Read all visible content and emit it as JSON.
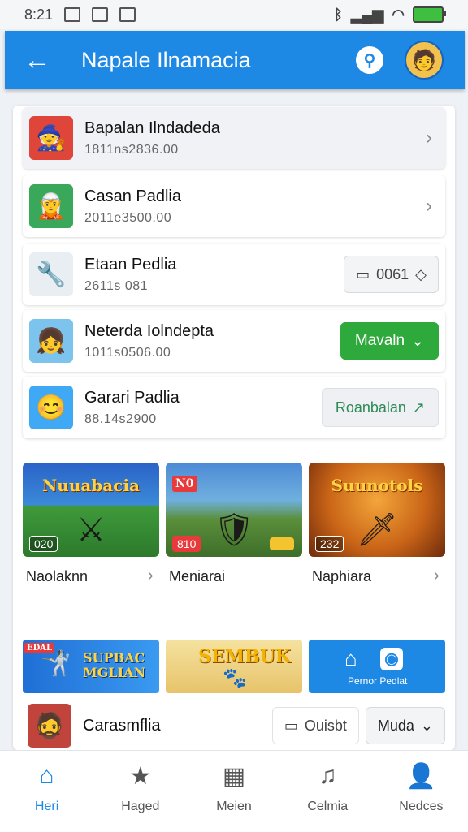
{
  "status": {
    "time": "8:21",
    "battery_color": "#3fbf3f"
  },
  "app_bar": {
    "title": "Napale Ilnamacia",
    "color": "#1e88e5"
  },
  "list_items": [
    {
      "title": "Bapalan Ilndadeda",
      "subtitle": "1811ns2836.00",
      "action": "chevron"
    },
    {
      "title": "Casan Padlia",
      "subtitle": "2011e3500.00",
      "action": "chevron"
    },
    {
      "title": "Etaan Pedlia",
      "subtitle": "2611s 081",
      "action": "outline",
      "action_label": "0061"
    },
    {
      "title": "Neterda Iolndepta",
      "subtitle": "1011s0506.00",
      "action": "green",
      "action_label": "Mavaln"
    },
    {
      "title": "Garari Padlia",
      "subtitle": "88.14s2900",
      "action": "light",
      "action_label": "Roanbalan"
    }
  ],
  "tiles": [
    {
      "title": "Nuuabacia",
      "tag": "020",
      "label": "Naolaknn"
    },
    {
      "title": "N0",
      "tag": "810",
      "label": "Meniarai"
    },
    {
      "title": "Suunotols",
      "tag": "232",
      "label": "Naphiara"
    }
  ],
  "banners": [
    {
      "title": "SUPBAC MGLIAN",
      "tag": "EDAL"
    },
    {
      "title": "SEMBUK"
    },
    {
      "title": "Pernor Pedlat"
    }
  ],
  "bottom_row": {
    "title": "Carasmflia",
    "button_label": "Ouisbt",
    "dropdown_label": "Muda"
  },
  "nav": [
    {
      "label": "Heri",
      "icon": "home-icon"
    },
    {
      "label": "Haged",
      "icon": "star-icon"
    },
    {
      "label": "Meien",
      "icon": "grid-icon"
    },
    {
      "label": "Celmia",
      "icon": "music-icon"
    },
    {
      "label": "Nedces",
      "icon": "person-icon"
    }
  ]
}
